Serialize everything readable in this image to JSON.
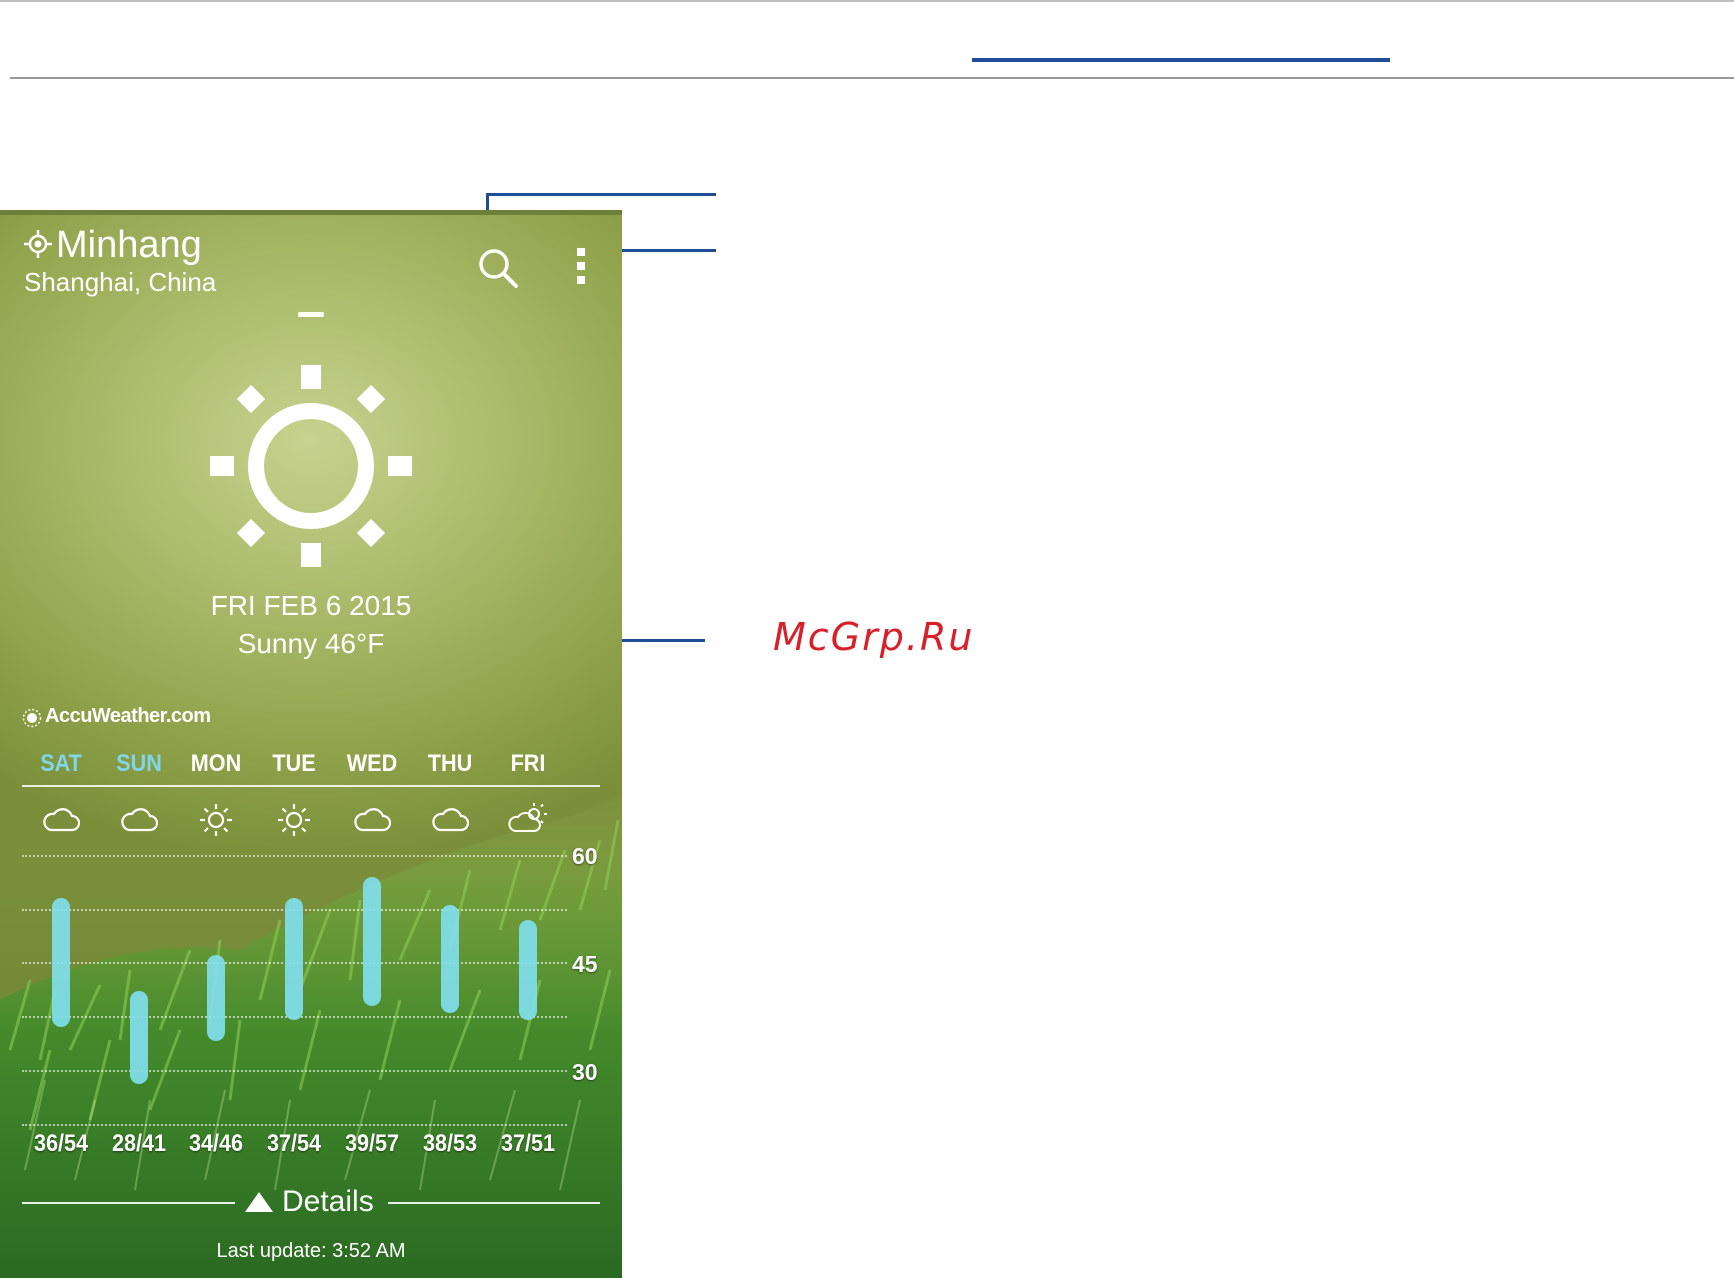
{
  "watermark": "McGrp.Ru",
  "weather": {
    "city": "Minhang",
    "region": "Shanghai, China",
    "date": "FRI FEB 6 2015",
    "condition": "Sunny 46°F",
    "provider": "AccuWeather.com",
    "icons": {
      "location": "location-pin-icon",
      "search": "search-icon",
      "menu": "more-vertical-icon",
      "weather": "sun-icon"
    },
    "forecast": [
      {
        "day": "SAT",
        "icon": "cloud-icon",
        "temps": "36/54",
        "low": 36,
        "high": 54,
        "active": true
      },
      {
        "day": "SUN",
        "icon": "cloud-icon",
        "temps": "28/41",
        "low": 28,
        "high": 41,
        "active": true
      },
      {
        "day": "MON",
        "icon": "sun-icon",
        "temps": "34/46",
        "low": 34,
        "high": 46,
        "active": false
      },
      {
        "day": "TUE",
        "icon": "sun-icon",
        "temps": "37/54",
        "low": 37,
        "high": 54,
        "active": false
      },
      {
        "day": "WED",
        "icon": "cloud-icon",
        "temps": "39/57",
        "low": 39,
        "high": 57,
        "active": false
      },
      {
        "day": "THU",
        "icon": "cloud-icon",
        "temps": "38/53",
        "low": 38,
        "high": 53,
        "active": false
      },
      {
        "day": "FRI",
        "icon": "partly-cloudy-icon",
        "temps": "37/51",
        "low": 37,
        "high": 51,
        "active": false
      }
    ],
    "y_ticks": [
      "60",
      "45",
      "30"
    ],
    "details_label": "Details",
    "last_update": "Last update: 3:52 AM",
    "accent_color": "#7fd6ea",
    "callout_color": "#1f4e96"
  }
}
